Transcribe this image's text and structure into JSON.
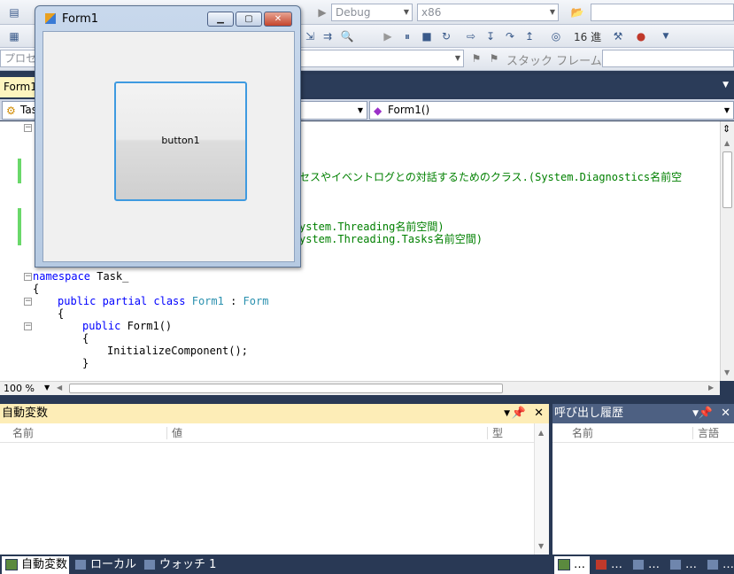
{
  "toolbar": {
    "config": "Debug",
    "platform": "x86",
    "hex_label": "16 進",
    "search_value": ""
  },
  "toolbar3": {
    "process_label": "プロセ",
    "stack_frame_label": "スタック フレーム"
  },
  "doc_tab": {
    "label": "Form1"
  },
  "navbar": {
    "left_combo": "Tas",
    "right_combo": "Form1()"
  },
  "code": {
    "comment1": "セスやイベントログとの対話するためのクラス.(System.Diagnostics名前空",
    "comment2": "ystem.Threading名前空間)",
    "comment3": "ystem.Threading.Tasks名前空間)",
    "kw_namespace": "namespace",
    "ns_name": " Task_",
    "brace_open1": "{",
    "kw_public_partial_class": "public partial class",
    "class_name": "Form1",
    "colon": " : ",
    "base_class": "Form",
    "brace_open2": "{",
    "kw_public": "public",
    "ctor": " Form1()",
    "brace_open3": "{",
    "init_call": "InitializeComponent();",
    "brace_close3": "}"
  },
  "zoom": "100 %",
  "autos_panel": {
    "title": "自動変数",
    "col_name": "名前",
    "col_value": "値",
    "col_type": "型"
  },
  "callstack_panel": {
    "title": "呼び出し履歴",
    "col_name": "名前",
    "col_lang": "言語"
  },
  "bottom_tabs": {
    "autos": "自動変数",
    "locals": "ローカル",
    "watch": "ウォッチ 1"
  },
  "form_window": {
    "title": "Form1",
    "button_label": "button1"
  }
}
